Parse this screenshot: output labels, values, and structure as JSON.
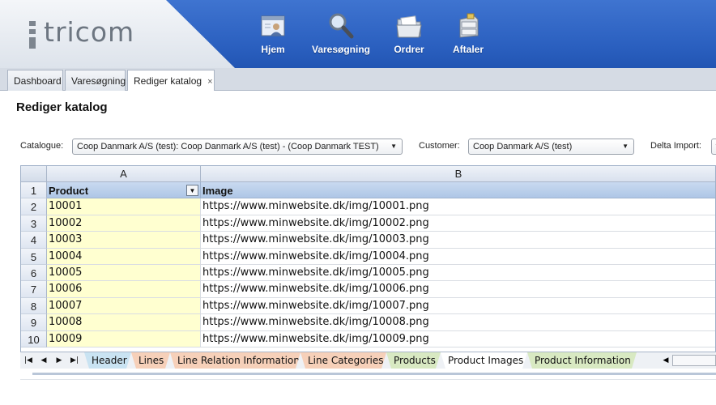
{
  "brand": {
    "name": "tricom"
  },
  "nav": [
    {
      "label": "Hjem",
      "icon": "home-icon"
    },
    {
      "label": "Varesøgning",
      "icon": "search-icon"
    },
    {
      "label": "Ordrer",
      "icon": "folder-icon"
    },
    {
      "label": "Aftaler",
      "icon": "agreement-icon"
    }
  ],
  "tabs": [
    {
      "label": "Dashboard"
    },
    {
      "label": "Varesøgning"
    },
    {
      "label": "Rediger katalog",
      "close": "×"
    }
  ],
  "page": {
    "title": "Rediger katalog"
  },
  "filters": {
    "catalogue_label": "Catalogue:",
    "catalogue_value": "Coop Danmark A/S (test): Coop Danmark A/S (test) - (Coop Danmark TEST)",
    "customer_label": "Customer:",
    "customer_value": "Coop Danmark A/S (test)",
    "delta_label": "Delta Import:"
  },
  "sheet": {
    "columns": [
      "A",
      "B"
    ],
    "header_row_number": "1",
    "headers": [
      "Product",
      "Image"
    ],
    "rows": [
      {
        "num": "2",
        "product": "10001",
        "image": "https://www.minwebsite.dk/img/10001.png"
      },
      {
        "num": "3",
        "product": "10002",
        "image": "https://www.minwebsite.dk/img/10002.png"
      },
      {
        "num": "4",
        "product": "10003",
        "image": "https://www.minwebsite.dk/img/10003.png"
      },
      {
        "num": "5",
        "product": "10004",
        "image": "https://www.minwebsite.dk/img/10004.png"
      },
      {
        "num": "6",
        "product": "10005",
        "image": "https://www.minwebsite.dk/img/10005.png"
      },
      {
        "num": "7",
        "product": "10006",
        "image": "https://www.minwebsite.dk/img/10006.png"
      },
      {
        "num": "8",
        "product": "10007",
        "image": "https://www.minwebsite.dk/img/10007.png"
      },
      {
        "num": "9",
        "product": "10008",
        "image": "https://www.minwebsite.dk/img/10008.png"
      },
      {
        "num": "10",
        "product": "10009",
        "image": "https://www.minwebsite.dk/img/10009.png"
      }
    ],
    "sheet_tabs": [
      {
        "label": "Header",
        "color": "#c9e3f2"
      },
      {
        "label": "Lines",
        "color": "#f6d0b9"
      },
      {
        "label": "Line Relation Information",
        "color": "#f6d0b9"
      },
      {
        "label": "Line Categories",
        "color": "#f6d0b9"
      },
      {
        "label": "Products",
        "color": "#d8e9c2"
      },
      {
        "label": "Product Images",
        "color": "#ffffff"
      },
      {
        "label": "Product Information",
        "color": "#d8e9c2"
      }
    ]
  }
}
